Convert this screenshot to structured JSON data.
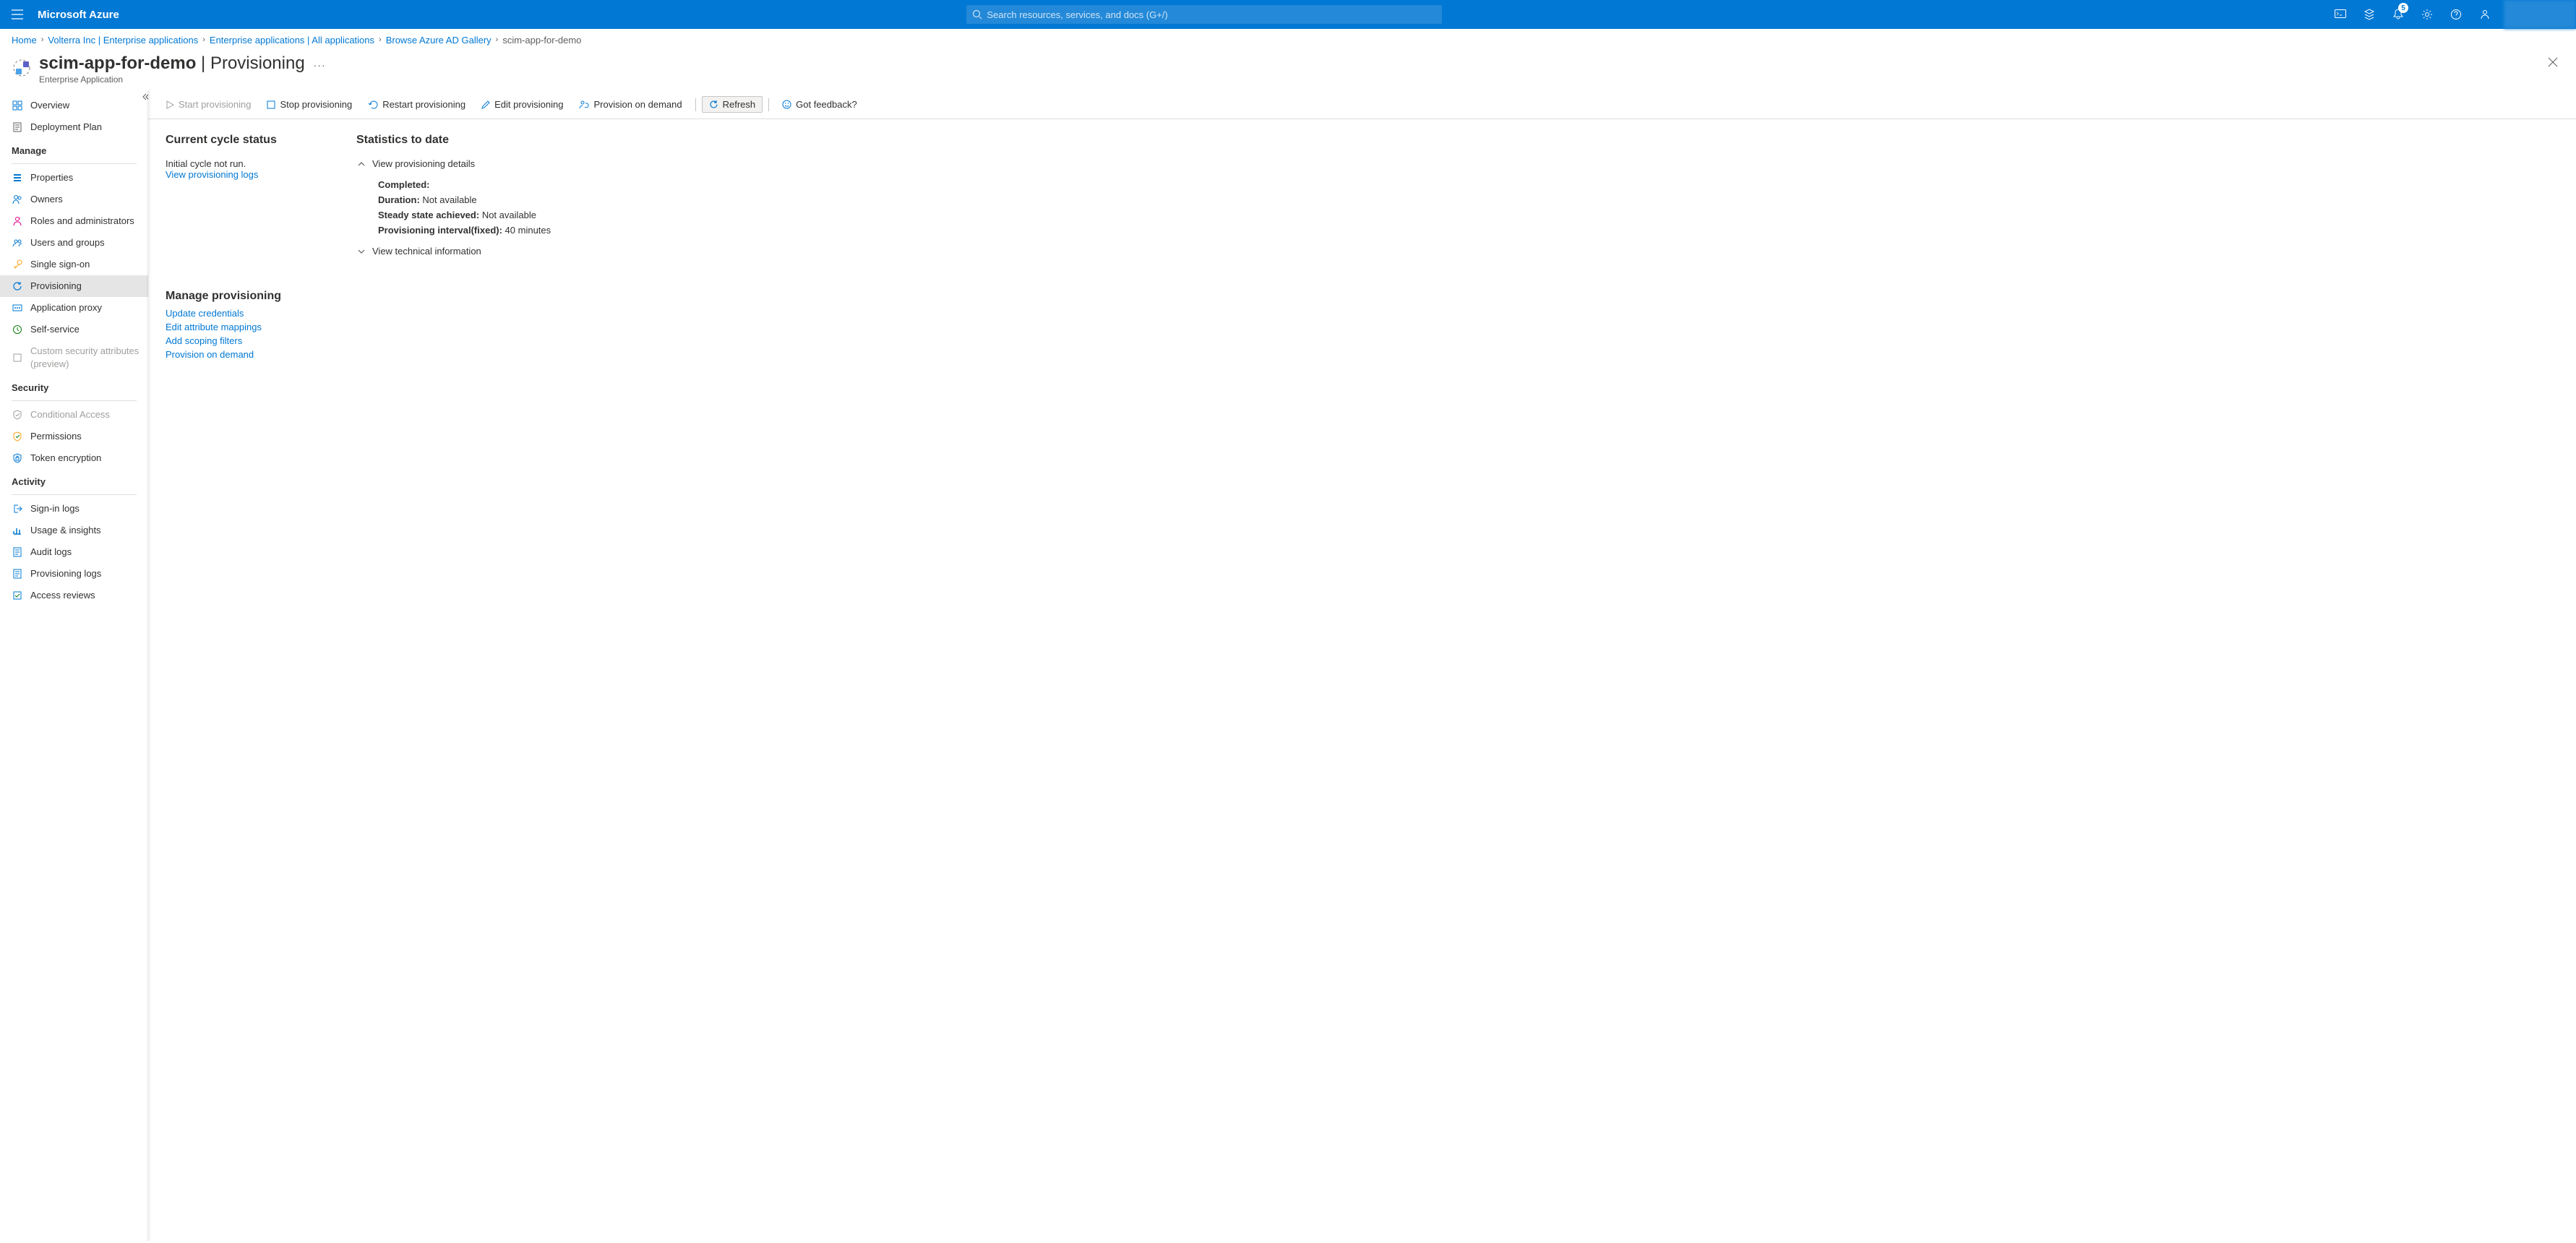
{
  "header": {
    "brand": "Microsoft Azure",
    "search_placeholder": "Search resources, services, and docs (G+/)",
    "notification_count": "5"
  },
  "breadcrumb": {
    "items": [
      {
        "label": "Home"
      },
      {
        "label": "Volterra Inc | Enterprise applications"
      },
      {
        "label": "Enterprise applications | All applications"
      },
      {
        "label": "Browse Azure AD Gallery"
      },
      {
        "label": "scim-app-for-demo"
      }
    ]
  },
  "title": {
    "name": "scim-app-for-demo",
    "section": "Provisioning",
    "subtitle": "Enterprise Application",
    "more": "···"
  },
  "leftnav": {
    "top": [
      {
        "label": "Overview"
      },
      {
        "label": "Deployment Plan"
      }
    ],
    "groups": [
      {
        "name": "Manage",
        "items": [
          {
            "label": "Properties"
          },
          {
            "label": "Owners"
          },
          {
            "label": "Roles and administrators"
          },
          {
            "label": "Users and groups"
          },
          {
            "label": "Single sign-on"
          },
          {
            "label": "Provisioning",
            "selected": true
          },
          {
            "label": "Application proxy"
          },
          {
            "label": "Self-service"
          },
          {
            "label": "Custom security attributes (preview)",
            "disabled": true
          }
        ]
      },
      {
        "name": "Security",
        "items": [
          {
            "label": "Conditional Access",
            "disabled": true
          },
          {
            "label": "Permissions"
          },
          {
            "label": "Token encryption"
          }
        ]
      },
      {
        "name": "Activity",
        "items": [
          {
            "label": "Sign-in logs"
          },
          {
            "label": "Usage & insights"
          },
          {
            "label": "Audit logs"
          },
          {
            "label": "Provisioning logs"
          },
          {
            "label": "Access reviews"
          }
        ]
      }
    ]
  },
  "toolbar": {
    "start": "Start provisioning",
    "stop": "Stop provisioning",
    "restart": "Restart provisioning",
    "edit": "Edit provisioning",
    "demand": "Provision on demand",
    "refresh": "Refresh",
    "feedback": "Got feedback?"
  },
  "content": {
    "cycle_head": "Current cycle status",
    "cycle_text": "Initial cycle not run.",
    "cycle_link": "View provisioning logs",
    "stats_head": "Statistics to date",
    "exp_details": "View provisioning details",
    "exp_tech": "View technical information",
    "details": {
      "completed_label": "Completed:",
      "duration_label": "Duration:",
      "duration_value": "Not available",
      "steady_label": "Steady state achieved:",
      "steady_value": "Not available",
      "interval_label": "Provisioning interval(fixed):",
      "interval_value": "40 minutes"
    },
    "manage_head": "Manage provisioning",
    "manage_links": [
      "Update credentials",
      "Edit attribute mappings",
      "Add scoping filters",
      "Provision on demand"
    ]
  }
}
